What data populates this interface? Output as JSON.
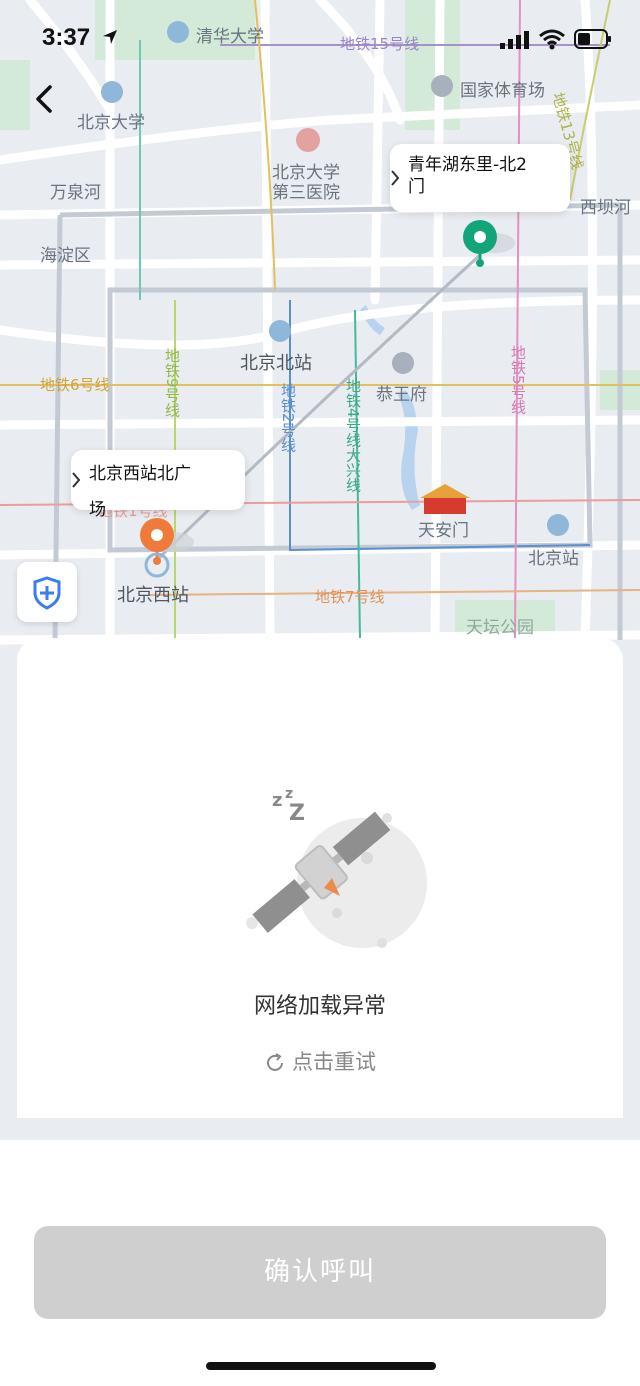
{
  "status_bar": {
    "time": "3:37"
  },
  "map": {
    "labels": {
      "tsinghua": "清华大学",
      "line15": "地铁15号线",
      "bird_nest": "国家体育场",
      "pku": "北京大学",
      "pku_hospital_1": "北京大学",
      "pku_hospital_2": "第三医院",
      "wanquanhe": "万泉河",
      "haidian": "海淀区",
      "xibahe": "西坝河",
      "beijing_north": "北京北站",
      "line6": "地铁6号线",
      "line9": "地铁9号线",
      "line2": "地铁2号线",
      "line4": "地铁4号线大兴线",
      "line5": "地铁5号线",
      "line13": "地铁13号线",
      "gongwangfu": "恭王府",
      "tiananmen": "天安门",
      "beijing_station": "北京站",
      "beijing_west": "北京西站",
      "line7": "地铁7号线",
      "line1_partial": "地铁1号线",
      "tiantan": "天坛公园"
    },
    "destination_callout": "青年湖东里-北2门",
    "origin_callout": "北京西站北广场"
  },
  "panel": {
    "error_text": "网络加载异常",
    "retry_text": "点击重试"
  },
  "bottom": {
    "confirm_label": "确认呼叫"
  },
  "colors": {
    "origin_pin": "#f07a3a",
    "destination_pin": "#13a57a",
    "button_disabled": "#cfcfcf",
    "shield": "#3a7cf2"
  }
}
